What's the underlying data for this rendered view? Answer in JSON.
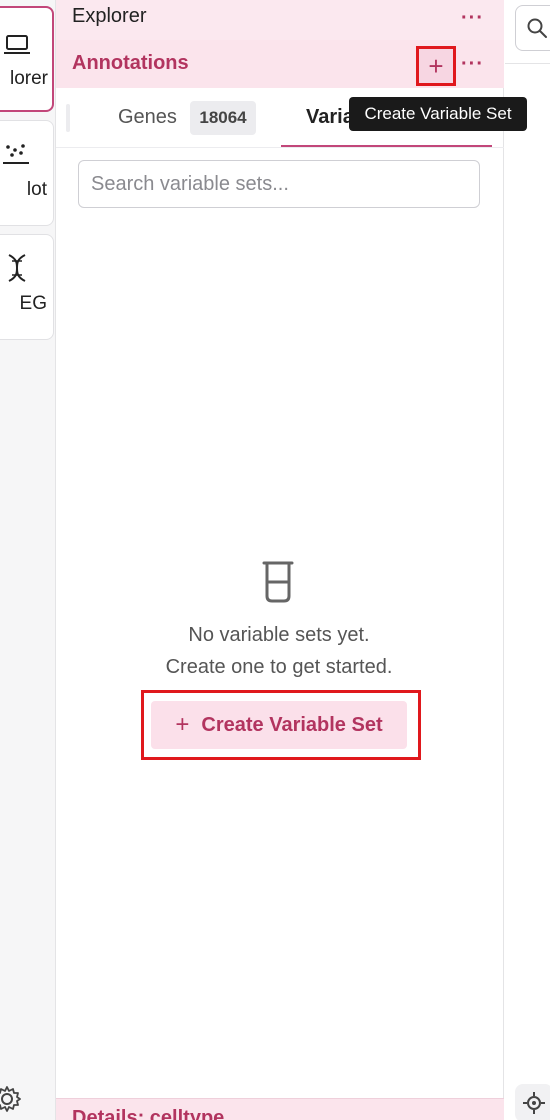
{
  "rail": {
    "items": [
      {
        "label": "lorer",
        "icon": "laptop-icon"
      },
      {
        "label": "lot",
        "icon": "scatter-plot-icon"
      },
      {
        "label": "EG",
        "icon": "dna-icon"
      }
    ],
    "settings_icon": "gear-icon"
  },
  "explorer": {
    "title": "Explorer"
  },
  "annotations": {
    "title": "Annotations",
    "add_button": "+",
    "tooltip": "Create Variable Set"
  },
  "tabs": {
    "genes_label": "Genes",
    "genes_count": "18064",
    "variables_label": "Varia"
  },
  "search": {
    "placeholder": "Search variable sets..."
  },
  "empty_state": {
    "icon": "beaker-icon",
    "line1": "No variable sets yet.",
    "line2": "Create one to get started.",
    "button_plus": "+",
    "button_label": "Create Variable Set"
  },
  "details": {
    "title": "Details: celltype"
  },
  "more_menu": "···",
  "colors": {
    "accent": "#b2345f",
    "header_bg": "#fbe4ec",
    "highlight": "#e0181d"
  }
}
